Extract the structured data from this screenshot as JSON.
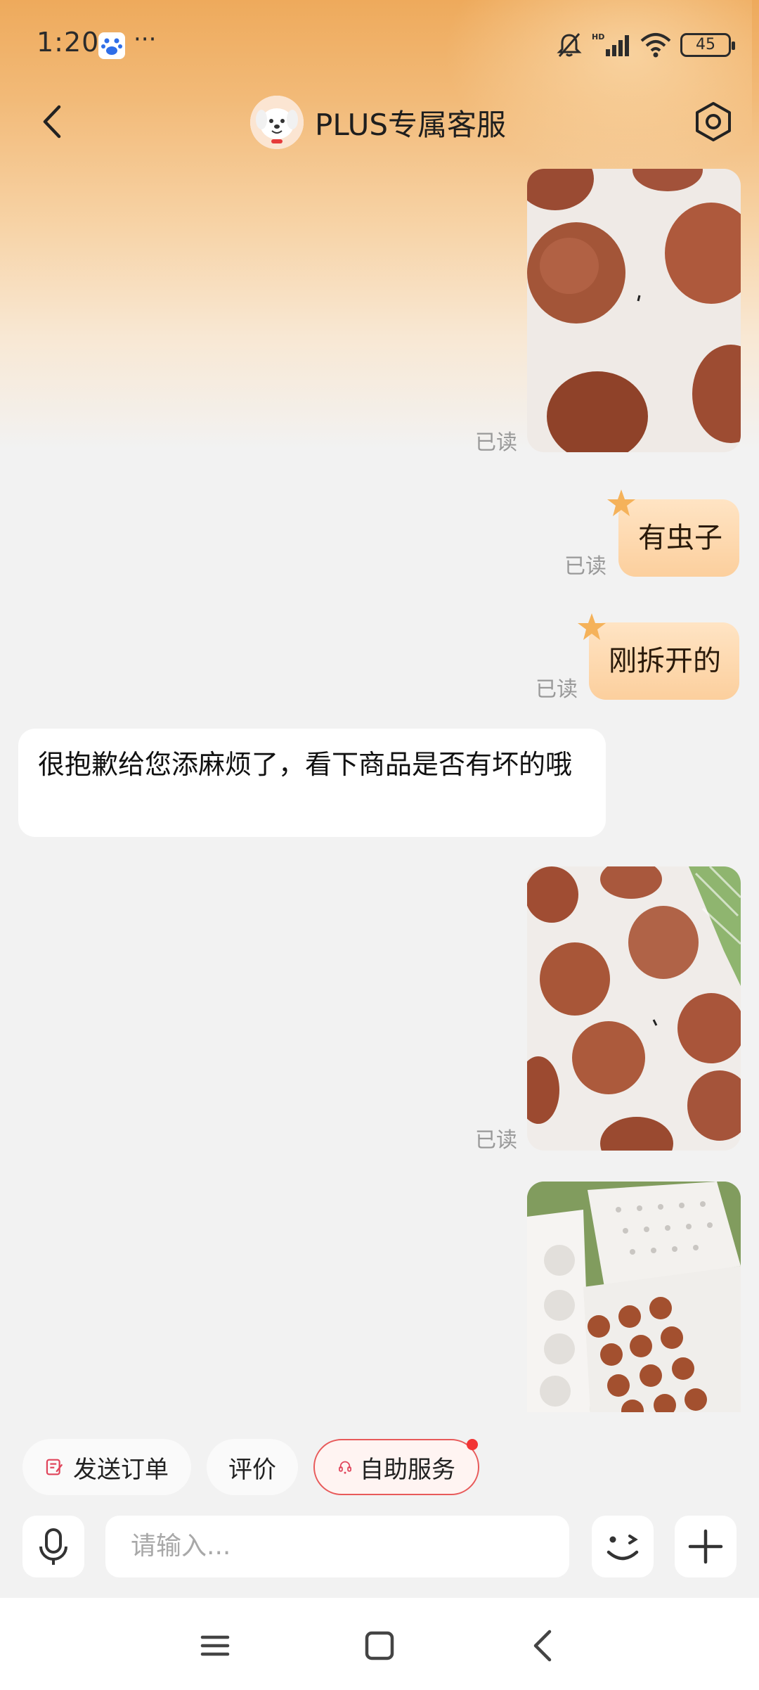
{
  "status": {
    "time": "1:20",
    "more": "···",
    "battery": "45",
    "network": "HD"
  },
  "header": {
    "title": "PLUS专属客服"
  },
  "messages": {
    "read_label": "已读",
    "m2_text": "有虫子",
    "m3_text": "刚拆开的",
    "m4_text": "很抱歉给您添麻烦了，看下商品是否有坏的哦"
  },
  "quick_actions": {
    "send_order": "发送订单",
    "review": "评价",
    "self_service": "自助服务"
  },
  "composer": {
    "placeholder": "请输入..."
  },
  "colors": {
    "accent": "#e85a5a",
    "bubble_me": "#fccf9d",
    "header_orange": "#eeaa5c"
  }
}
